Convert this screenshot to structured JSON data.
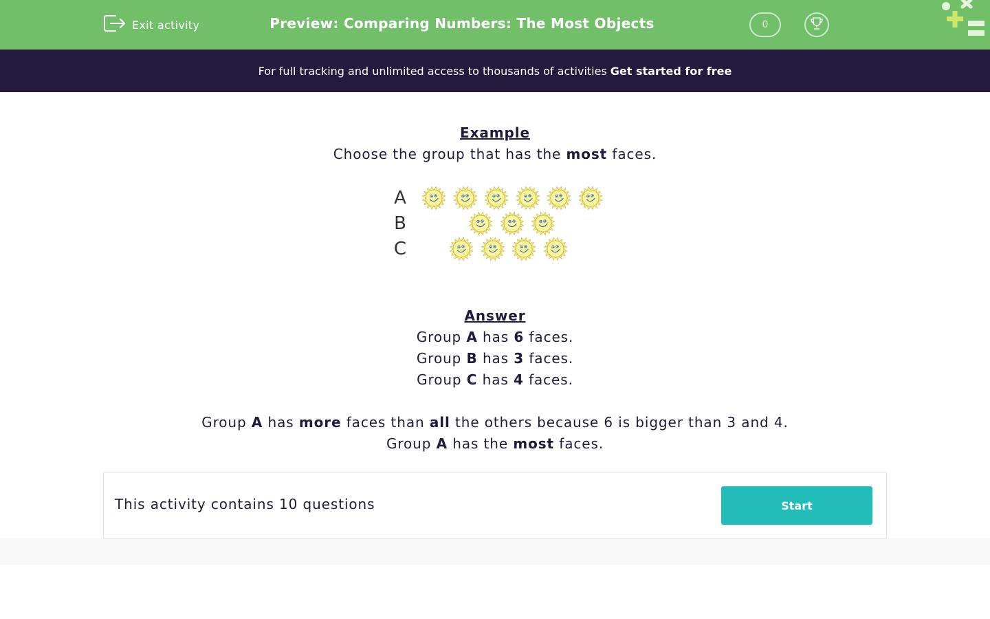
{
  "header": {
    "exit_label": "Exit activity",
    "title": "Preview: Comparing Numbers: The Most Objects",
    "score": "0",
    "exit_icon": "exit-icon",
    "trophy_icon": "trophy-icon",
    "bg_color": "#72bf6a"
  },
  "banner": {
    "text": "For full tracking and unlimited access to thousands of activities",
    "cta": "Get started for free",
    "bg_color": "#231a3e"
  },
  "example": {
    "heading": "Example",
    "question_pre": "Choose the group that has the",
    "question_bold": "most",
    "question_post": "faces.",
    "groups": [
      {
        "label": "A",
        "count": 6
      },
      {
        "label": "B",
        "count": 3
      },
      {
        "label": "C",
        "count": 4
      }
    ],
    "face_icon": "smiling-sun-icon"
  },
  "answer": {
    "heading": "Answer",
    "lines": [
      {
        "pre": "Group",
        "group": "A",
        "mid": "has",
        "count": "6",
        "post": "faces."
      },
      {
        "pre": "Group",
        "group": "B",
        "mid": "has",
        "count": "3",
        "post": "faces."
      },
      {
        "pre": "Group",
        "group": "C",
        "mid": "has",
        "count": "4",
        "post": "faces."
      }
    ],
    "explanation": {
      "p1": "Group",
      "g": "A",
      "p2": "has",
      "more": "more",
      "p3": "faces than",
      "all": "all",
      "p4": "the others because 6 is bigger than 3 and 4."
    },
    "conclusion": {
      "p1": "Group",
      "g": "A",
      "p2": "has the",
      "most": "most",
      "p3": "faces."
    }
  },
  "footer": {
    "activity_text": "This activity contains 10 questions",
    "start_label": "Start",
    "button_color": "#23bdb9"
  }
}
